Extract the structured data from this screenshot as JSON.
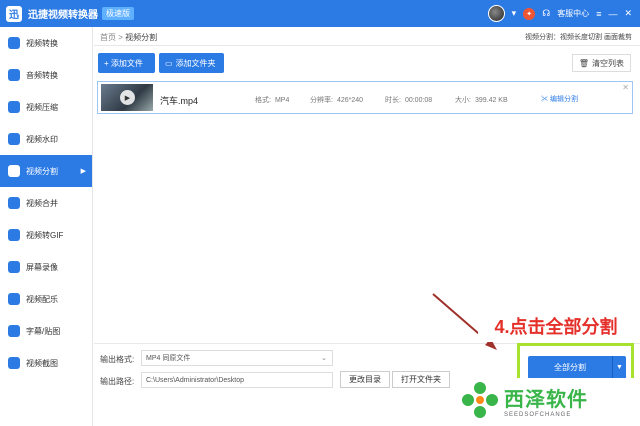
{
  "titlebar": {
    "app_title": "迅捷视频转换器",
    "edition": "极速版",
    "service": "客服中心",
    "logo_glyph": "迅"
  },
  "sidebar": {
    "items": [
      {
        "label": "视频转换",
        "icon": "video-convert-icon"
      },
      {
        "label": "音频转换",
        "icon": "audio-convert-icon"
      },
      {
        "label": "视频压缩",
        "icon": "video-compress-icon"
      },
      {
        "label": "视频水印",
        "icon": "video-watermark-icon"
      },
      {
        "label": "视频分割",
        "icon": "video-split-icon",
        "active": true
      },
      {
        "label": "视频合并",
        "icon": "video-merge-icon"
      },
      {
        "label": "视频转GIF",
        "icon": "video-gif-icon"
      },
      {
        "label": "屏幕录像",
        "icon": "screen-record-icon"
      },
      {
        "label": "视频配乐",
        "icon": "video-music-icon"
      },
      {
        "label": "字幕/贴图",
        "icon": "subtitle-icon"
      },
      {
        "label": "视频截图",
        "icon": "video-screenshot-icon"
      }
    ]
  },
  "breadcrumb": {
    "home": "首页",
    "sep": ">",
    "current": "视频分割"
  },
  "top_links": "视频分割：视频长度切割 画面裁剪",
  "toolbar": {
    "add_file": "+ 添加文件",
    "add_folder": "添加文件夹",
    "clear_list": "清空列表"
  },
  "file": {
    "name": "汽车.mp4",
    "format_label": "格式:",
    "format": "MP4",
    "resolution_label": "分辨率:",
    "resolution": "426*240",
    "duration_label": "时长:",
    "duration": "00:00:08",
    "size_label": "大小:",
    "size": "399.42 KB",
    "edit": "编辑分割"
  },
  "output": {
    "format_label": "输出格式:",
    "format_value": "MP4  同原文件",
    "path_label": "输出路径:",
    "path_value": "C:\\Users\\Administrator\\Desktop",
    "change_dir": "更改目录",
    "open_folder": "打开文件夹"
  },
  "split_all": "全部分割",
  "annotation": "4.点击全部分割",
  "watermark": {
    "title": "西泽软件",
    "sub": "SEEDSOFCHANGE"
  },
  "colors": {
    "primary": "#2c7be5",
    "annotation": "#e5302a",
    "highlight": "#a6e22e",
    "brand_green": "#39b54a"
  }
}
